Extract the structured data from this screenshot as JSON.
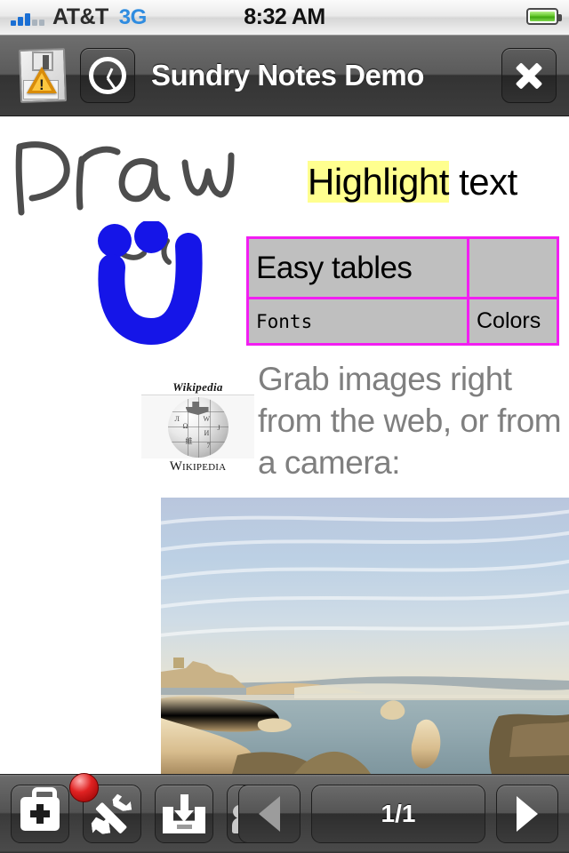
{
  "status_bar": {
    "carrier": "AT&T",
    "network": "3G",
    "time": "8:32 AM",
    "signal_icon": "signal-bars-icon",
    "battery_icon": "battery-full-icon"
  },
  "nav_bar": {
    "title": "Sundry Notes Demo",
    "save_icon": "floppy-save-warning-icon",
    "clock_icon": "clock-icon",
    "close_icon": "close-x-icon"
  },
  "note": {
    "drawing_label": "Draw",
    "smiley_drawing": "blue-smiley-drawing",
    "highlight": {
      "highlighted_word": "Highlight",
      "plain_word": " text",
      "highlight_color": "#ffff8f"
    },
    "table": {
      "border_color": "#f21ef2",
      "cell_background": "#bfbfbf",
      "rows": [
        [
          "Easy tables",
          ""
        ],
        [
          "Fonts",
          "Colors"
        ]
      ],
      "colors_text_color": "#ff0000"
    },
    "wikipedia_logo": {
      "top_wordmark": "Wikipedia",
      "bottom_wordmark": "Wikipedia",
      "globe_glyphs": [
        "W",
        "Ω",
        "И",
        "7",
        "維"
      ]
    },
    "paragraph": "Grab images right from the web, or from a camera:",
    "paragraph_color": "#7f7f7f",
    "photo_caption": "coastal-cliffs-photo"
  },
  "toolbar": {
    "buttons": [
      {
        "name": "toolkit-bag-button",
        "icon": "medical-bag-icon"
      },
      {
        "name": "tools-button",
        "icon": "wrench-icon",
        "badge": true
      },
      {
        "name": "import-button",
        "icon": "inbox-download-icon"
      },
      {
        "name": "share-button",
        "icon": "people-wifi-icon"
      }
    ],
    "prev_label": "prev-page-arrow",
    "next_label": "next-page-arrow",
    "page_indicator": "1/1"
  }
}
